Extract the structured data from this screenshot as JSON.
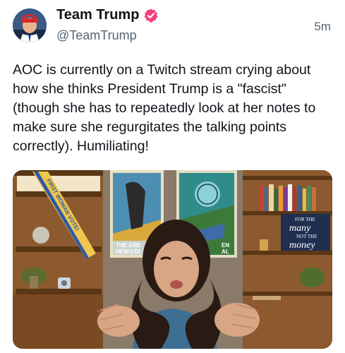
{
  "author": {
    "display_name": "Team Trump",
    "handle": "@TeamTrump",
    "verified_icon": "verified-badge-icon",
    "verified_color": "#f6407b"
  },
  "timestamp": "5m",
  "post_text": "AOC is currently on a Twitch stream crying about how she thinks President Trump is a \"fascist\" (though she has to repeatedly look at her notes to make sure she regurgitates the talking points correctly). Humiliating!",
  "media": {
    "sash_text": "FIRST WOMAN VOTE!",
    "poster_left_text": [
      "THE GRE",
      "NEW@DI"
    ],
    "poster_right_text": [
      "EN",
      "AL"
    ],
    "sign_lines": [
      "FOR THE",
      "many",
      "NOT THE",
      "money"
    ]
  },
  "colors": {
    "text_primary": "#0f1419",
    "text_secondary": "#536471"
  }
}
